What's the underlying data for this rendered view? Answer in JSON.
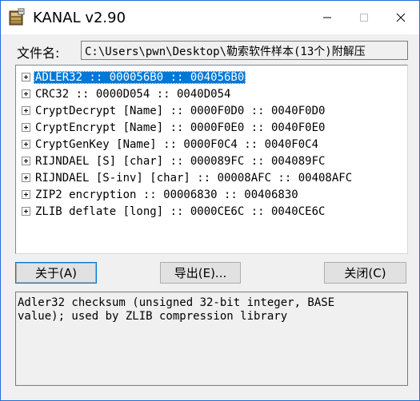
{
  "window": {
    "title": "KANAL v2.90",
    "icon": "kanal-app-icon",
    "controls": {
      "minimize": "minimize-icon",
      "maximize": "maximize-icon",
      "close": "close-icon"
    }
  },
  "file": {
    "label": "文件名:",
    "value": "C:\\Users\\pwn\\Desktop\\勒索软件样本(13个)附解压"
  },
  "tree": {
    "items": [
      {
        "label": "ADLER32 :: 000056B0 :: 004056B0",
        "selected": true
      },
      {
        "label": "CRC32 :: 0000D054 :: 0040D054"
      },
      {
        "label": "CryptDecrypt [Name] :: 0000F0D0 :: 0040F0D0"
      },
      {
        "label": "CryptEncrypt [Name] :: 0000F0E0 :: 0040F0E0"
      },
      {
        "label": "CryptGenKey [Name] :: 0000F0C4 :: 0040F0C4"
      },
      {
        "label": "RIJNDAEL [S] [char] :: 000089FC :: 004089FC"
      },
      {
        "label": "RIJNDAEL [S-inv] [char] :: 00008AFC :: 00408AFC"
      },
      {
        "label": "ZIP2 encryption :: 00006830 :: 00406830"
      },
      {
        "label": "ZLIB deflate [long] :: 0000CE6C :: 0040CE6C"
      }
    ]
  },
  "buttons": {
    "about": "关于(A)",
    "export": "导出(E)...",
    "close": "关闭(C)"
  },
  "description": "Adler32 checksum (unsigned 32-bit integer, BASE\nvalue); used by ZLIB compression library",
  "colors": {
    "selection": "#0078d7",
    "window_border": "#1e6fd9",
    "face": "#f0f0f0"
  }
}
